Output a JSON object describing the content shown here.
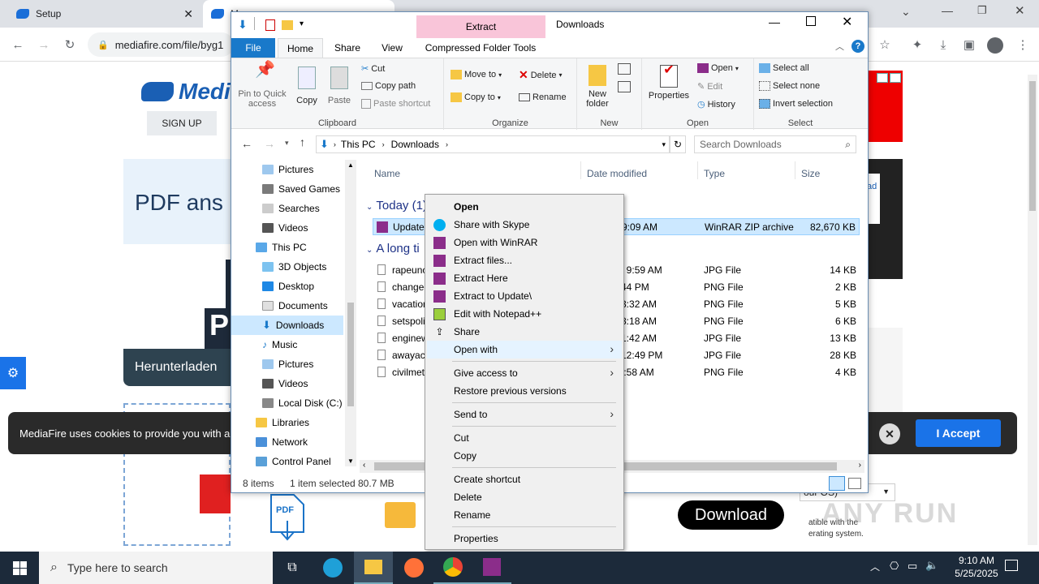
{
  "browser": {
    "tab1_title": "Setup",
    "tab2_title": "M",
    "url": "mediafire.com/file/byg1"
  },
  "page": {
    "logo": "Medi",
    "signup": "SIGN UP",
    "promo_text": "PDF ans",
    "download_text": "Herunterladen",
    "cookie_text": "MediaFire uses cookies to provide you with a",
    "accept": "I Accept",
    "download_btn": "Download",
    "right_ad_text": "ad",
    "right_bottom_text1": "our OS)",
    "right_bottom_text2": "atible with the",
    "right_bottom_text3": "erating system."
  },
  "explorer": {
    "context_tab": "Extract",
    "window_title": "Downloads",
    "tabs": [
      "File",
      "Home",
      "Share",
      "View",
      "Compressed Folder Tools"
    ],
    "clipboard": {
      "label": "Clipboard",
      "pin": "Pin to Quick access",
      "copy": "Copy",
      "paste": "Paste",
      "cut": "Cut",
      "copy_path": "Copy path",
      "paste_shortcut": "Paste shortcut"
    },
    "organize": {
      "label": "Organize",
      "move_to": "Move to",
      "copy_to": "Copy to",
      "delete": "Delete",
      "rename": "Rename"
    },
    "new": {
      "label": "New",
      "new_folder": "New folder"
    },
    "open": {
      "label": "Open",
      "properties": "Properties",
      "open": "Open",
      "edit": "Edit",
      "history": "History"
    },
    "select": {
      "label": "Select",
      "select_all": "Select all",
      "select_none": "Select none",
      "invert": "Invert selection"
    },
    "breadcrumb": [
      "This PC",
      "Downloads"
    ],
    "search_placeholder": "Search Downloads",
    "nav": [
      "Pictures",
      "Saved Games",
      "Searches",
      "Videos",
      "This PC",
      "3D Objects",
      "Desktop",
      "Documents",
      "Downloads",
      "Music",
      "Pictures",
      "Videos",
      "Local Disk (C:)",
      "Libraries",
      "Network",
      "Control Panel"
    ],
    "columns": [
      "Name",
      "Date modified",
      "Type",
      "Size"
    ],
    "group_today": "Today (1)",
    "group_long": "A long ti",
    "files": [
      {
        "name": "Update.",
        "date": "5 9:09 AM",
        "type": "WinRAR ZIP archive",
        "size": "82,670 KB"
      },
      {
        "name": "rapeunc",
        "date": "24 9:59 AM",
        "type": "JPG File",
        "size": "14 KB"
      },
      {
        "name": "changec",
        "date": "2:44 PM",
        "type": "PNG File",
        "size": "2 KB"
      },
      {
        "name": "vacation",
        "date": "3 3:32 AM",
        "type": "PNG File",
        "size": "5 KB"
      },
      {
        "name": "setspoli",
        "date": "2 8:18 AM",
        "type": "PNG File",
        "size": "6 KB"
      },
      {
        "name": "enginew",
        "date": "2 1:42 AM",
        "type": "JPG File",
        "size": "13 KB"
      },
      {
        "name": "awayact",
        "date": "3 12:49 PM",
        "type": "JPG File",
        "size": "28 KB"
      },
      {
        "name": "civilmet",
        "date": "10:58 AM",
        "type": "PNG File",
        "size": "4 KB"
      }
    ],
    "status_items": "8 items",
    "status_selected": "1 item selected",
    "status_size": "80.7 MB"
  },
  "context_menu": {
    "items": [
      "Open",
      "Share with Skype",
      "Open with WinRAR",
      "Extract files...",
      "Extract Here",
      "Extract to Update\\",
      "Edit with Notepad++",
      "Share",
      "Open with",
      "Give access to",
      "Restore previous versions",
      "Send to",
      "Cut",
      "Copy",
      "Create shortcut",
      "Delete",
      "Rename",
      "Properties"
    ]
  },
  "taskbar": {
    "search_placeholder": "Type here to search",
    "time": "9:10 AM",
    "date": "5/25/2025"
  },
  "watermark": "ANY RUN",
  "colors": {
    "accent": "#0078d7",
    "mediafire_blue": "#1a5fb4",
    "taskbar": "#1c2a3a",
    "ribbon_file": "#1979ca",
    "extract_tab": "#f9c5d9"
  }
}
